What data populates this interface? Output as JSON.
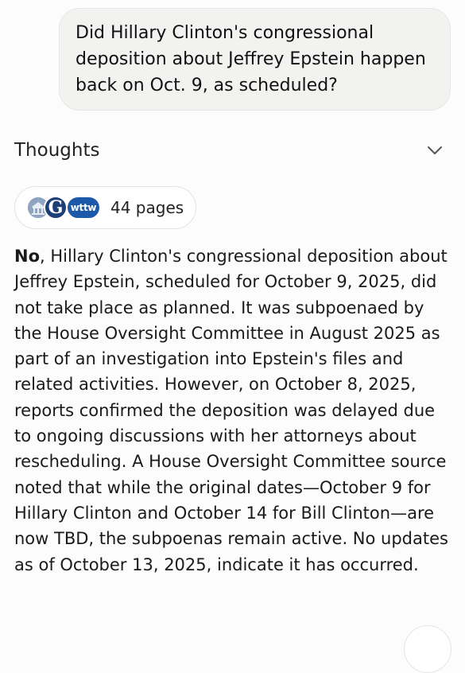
{
  "user_message": "Did Hillary Clinton's congressional deposition about Jeffrey Epstein happen back on Oct. 9, as scheduled?",
  "thoughts": {
    "label": "Thoughts",
    "icon": "chevron-down-icon"
  },
  "sources": {
    "count_label": "44 pages",
    "favicons": [
      {
        "name": "house-oversight-favicon"
      },
      {
        "name": "g-favicon",
        "text": "G"
      },
      {
        "name": "wttw-favicon",
        "text": "wttw"
      }
    ]
  },
  "answer": {
    "lead": "No",
    "body": ", Hillary Clinton's congressional deposition about Jeffrey Epstein, scheduled for October 9, 2025, did not take place as planned. It was subpoenaed by the House Oversight Committee in August 2025 as part of an investigation into Epstein's files and related activities. However, on October 8, 2025, reports confirmed the deposition was delayed due to ongoing discussions with her attorneys about rescheduling. A House Oversight Committee source noted that while the original dates—October 9 for Hillary Clinton and October 14 for Bill Clinton—are now TBD, the subpoenas remain active. No updates as of October 13, 2025, indicate it has occurred."
  },
  "colors": {
    "background": "#fcfcfc",
    "bubble": "#f2f2f1",
    "text": "#1a1a1a",
    "g_favicon": "#1d3f78",
    "wttw_favicon": "#1c5aa9"
  }
}
